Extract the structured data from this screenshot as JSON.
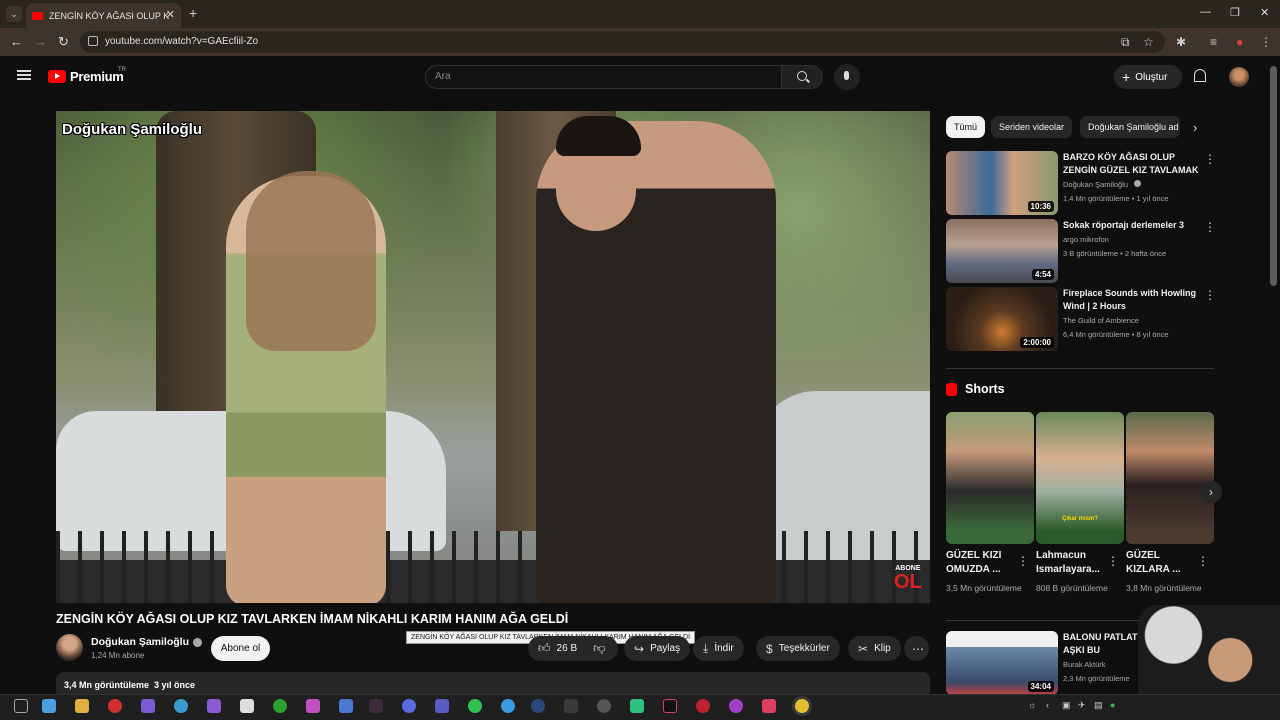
{
  "browser": {
    "tab_title": "ZENGİN KÖY AĞASI OLUP K",
    "url": "youtube.com/watch?v=GAEcfiil-Zo"
  },
  "header": {
    "logo_text": "Premium",
    "country": "TR",
    "search_placeholder": "Ara",
    "create_label": "Oluştur"
  },
  "video": {
    "overlay_title": "Doğukan Şamiloğlu",
    "overlay_abone": "ABONE",
    "overlay_ol": "OL",
    "title": "ZENGİN KÖY AĞASI OLUP KIZ TAVLARKEN İMAM NİKAHLI KARIM HANIM AĞA GELDİ",
    "tooltip": "ZENGİN KÖY AĞASI OLUP KIZ TAVLARKEN İMAM NİKAHLI KARIM HANIM AĞA GELDİ",
    "channel": "Doğukan Şamiloğlu",
    "subscribers": "1,24 Mn abone",
    "subscribe_label": "Abone ol",
    "likes": "26 B",
    "share_label": "Paylaş",
    "download_label": "İndir",
    "thanks_label": "Teşekkürler",
    "clip_label": "Klip",
    "views_line": "3,4 Mn görüntüleme  3 yıl önce"
  },
  "chips": [
    "Tümü",
    "Seriden videolar",
    "Doğukan Şamiloğlu ad"
  ],
  "recommendations": [
    {
      "title": "BARZO KÖY AĞASI OLUP ZENGİN GÜZEL KIZ TAVLAMAK",
      "channel": "Doğukan Şamiloğlu",
      "meta": "1,4 Mn görüntüleme • 1 yıl önce",
      "duration": "10:36",
      "verified": true
    },
    {
      "title": "Sokak röportajı derlemeler 3",
      "channel": "argo mikrofon",
      "meta": "3 B görüntüleme • 2 hafta önce",
      "duration": "4:54",
      "verified": false
    },
    {
      "title": "Fireplace Sounds with Howling Wind | 2 Hours",
      "channel": "The Guild of Ambience",
      "meta": "6,4 Mn görüntüleme • 8 yıl önce",
      "duration": "2:00:00",
      "verified": false
    },
    {
      "title": "BALONU PATLAT V GERÇEK AŞKI BU",
      "channel": "Burak Aktürk",
      "meta": "2,3 Mn görüntüleme",
      "duration": "34:04",
      "verified": true
    }
  ],
  "shorts": {
    "heading": "Shorts",
    "items": [
      {
        "title": "GÜZEL KIZI OMUZDA ...",
        "views": "3,5 Mn görüntüleme"
      },
      {
        "title": "Lahmacun Ismarlayara...",
        "views": "808 B görüntüleme"
      },
      {
        "title": "GÜZEL KIZLARA ...",
        "views": "3,8 Mn görüntüleme"
      }
    ],
    "overlay_caption": "Çıkar mısın?"
  },
  "colors": {
    "accent": "#ff0000",
    "bg": "#0f0f0f",
    "chip": "#272727"
  }
}
